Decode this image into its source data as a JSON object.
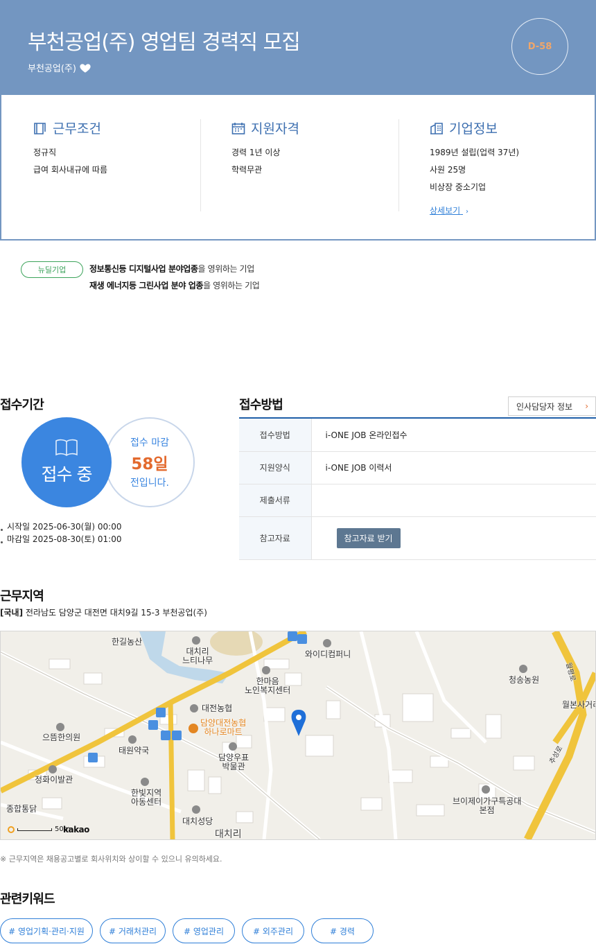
{
  "header": {
    "title": "부천공업(주) 영업팀 경력직 모집",
    "company": "부천공업(주)",
    "dday": "D-58",
    "heart_icon": "heart-icon"
  },
  "conditions": {
    "work": {
      "title": "근무조건",
      "lines": [
        "정규직",
        "급여 회사내규에 따름"
      ]
    },
    "qualification": {
      "title": "지원자격",
      "lines": [
        "경력 1년 이상",
        "학력무관"
      ]
    },
    "company": {
      "title": "기업정보",
      "lines": [
        "1989년 설립(업력 37년)",
        "사원 25명",
        "비상장 중소기업"
      ],
      "more": "상세보기"
    }
  },
  "newdeal": {
    "badge": "뉴딜기업",
    "lines": [
      {
        "bold": "정보통신등 디지털사업 분야업종",
        "rest": "을 영위하는 기업"
      },
      {
        "bold": "재생 에너지등 그린사업 분야 업종",
        "rest": "을 영위하는 기업"
      }
    ]
  },
  "period": {
    "title": "접수기간",
    "status": "접수 중",
    "deadline_prefix": "접수 마감",
    "days_left": "58일",
    "deadline_suffix": "전입니다.",
    "start": "시작일 2025-06-30(월) 00:00",
    "end": "마감일 2025-08-30(토) 01:00"
  },
  "method": {
    "title": "접수방법",
    "hr_button": "인사담당자 정보",
    "rows": [
      {
        "label": "접수방법",
        "value": "i-ONE JOB 온라인접수"
      },
      {
        "label": "지원양식",
        "value": "i-ONE JOB 이력서"
      },
      {
        "label": "제출서류",
        "value": ""
      },
      {
        "label": "참고자료",
        "value": "참고자료 받기"
      }
    ]
  },
  "region": {
    "title": "근무지역",
    "tag": "[국내]",
    "address": "전라남도 담양군 대전면 대치9길 15-3 부천공업(주)",
    "notice": "※ 근무지역은 채용공고별로 회사위치와 상이할 수 있으니 유의하세요.",
    "map_labels": {
      "hangil": "한길농산",
      "daechi_school": "대치리\n느티나무",
      "wide": "와이디컴퍼니",
      "hanmaeum": "한마음\n노인복지센터",
      "cheongsong": "청송농원",
      "daejeon_nh": "대전농협",
      "mart": "담양대전농협\n하나로마트",
      "wolbon": "월본사거리",
      "eutteum": "으뜸한의원",
      "taewon": "태원약국",
      "museum": "담양우표\n박물관",
      "jeonghwa": "정화이발관",
      "hanbit": "한빛지역\n아동센터",
      "bj": "브이제이가구특공대\n본점",
      "jonghap": "종합통닭",
      "daechisung": "대치성당",
      "daechiri": "대치리",
      "road1": "월평로",
      "road2": "추성로"
    },
    "scale": "50m",
    "brand": "kakao"
  },
  "keywords": {
    "title": "관련키워드",
    "items": [
      "# 영업기획·관리·지원",
      "# 거래처관리",
      "# 영업관리",
      "# 외주관리",
      "# 경력"
    ]
  }
}
